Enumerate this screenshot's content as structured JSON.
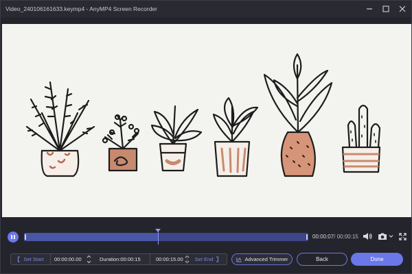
{
  "window": {
    "title": "Video_240106161633.keymp4  -  AnyMP4 Screen Recorder",
    "controls": [
      "minimize-icon",
      "maximize-icon",
      "close-icon"
    ]
  },
  "preview": {
    "content": "hand-drawn potted plants illustration",
    "background": "#f3f3ef"
  },
  "timeline": {
    "current_time": "00:00:07",
    "total_time": "/ 00:00:15",
    "progress_fraction": 0.47,
    "play_state_icon": "pause-icon",
    "accent": "#6a78e8"
  },
  "tools": {
    "volume_icon": "volume-icon",
    "camera_icon": "camera-icon",
    "camera_dropdown_icon": "chevron-down-icon",
    "fullscreen_icon": "fullscreen-icon"
  },
  "trim": {
    "set_start_label": "Set Start",
    "start_value": "00:00:00.00",
    "duration_label": "Duration:00:00:15",
    "end_value": "00:00:15.00",
    "set_end_label": "Set End"
  },
  "actions": {
    "advanced_trimmer_label": "Advanced Trimmer",
    "back_label": "Back",
    "done_label": "Done"
  }
}
